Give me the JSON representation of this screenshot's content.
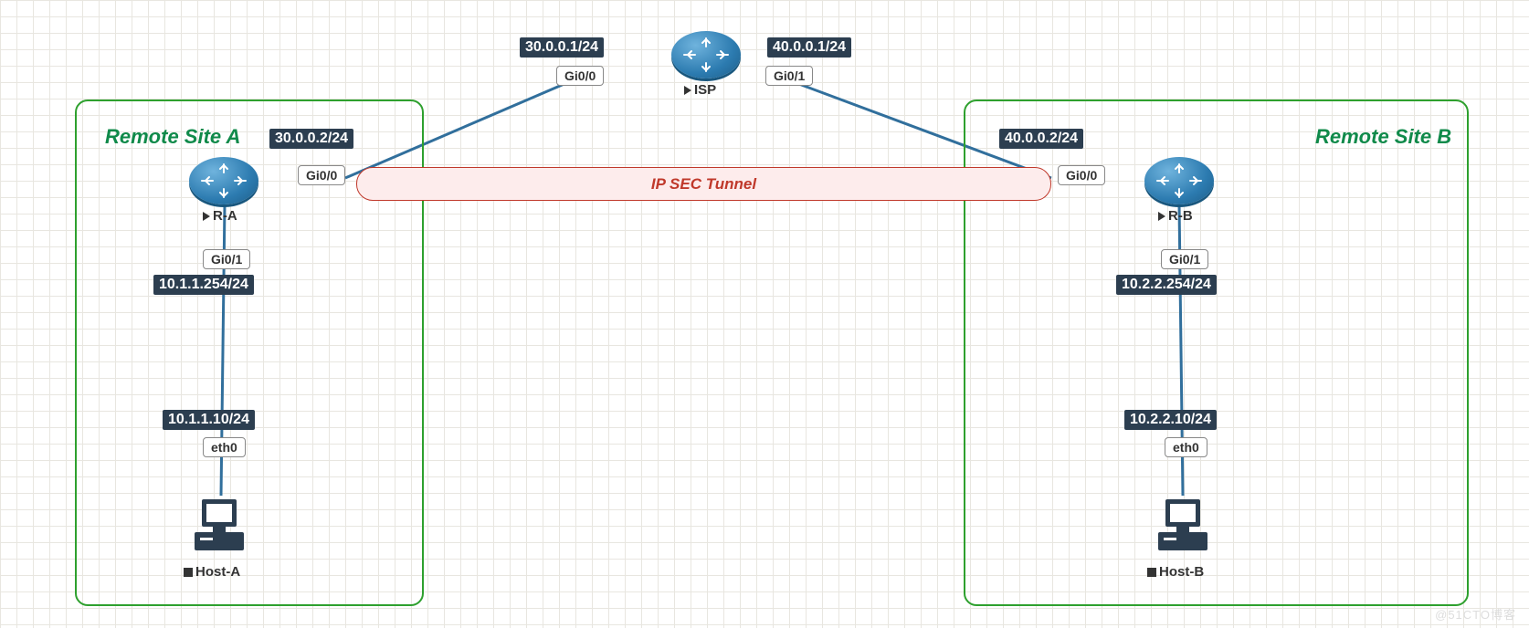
{
  "sites": {
    "a": {
      "title": "Remote Site A"
    },
    "b": {
      "title": "Remote Site B"
    }
  },
  "tunnel": {
    "label": "IP SEC Tunnel"
  },
  "devices": {
    "isp": {
      "label": "ISP",
      "type": "router"
    },
    "ra": {
      "label": "R-A",
      "type": "router"
    },
    "rb": {
      "label": "R-B",
      "type": "router"
    },
    "hosta": {
      "label": "Host-A",
      "type": "host"
    },
    "hostb": {
      "label": "Host-B",
      "type": "host"
    }
  },
  "addresses": {
    "isp_g00": "30.0.0.1/24",
    "isp_g01": "40.0.0.1/24",
    "ra_g00": "30.0.0.2/24",
    "rb_g00": "40.0.0.2/24",
    "ra_g01": "10.1.1.254/24",
    "rb_g01": "10.2.2.254/24",
    "hosta": "10.1.1.10/24",
    "hostb": "10.2.2.10/24"
  },
  "ports": {
    "isp_g00": "Gi0/0",
    "isp_g01": "Gi0/1",
    "ra_g00": "Gi0/0",
    "rb_g00": "Gi0/0",
    "ra_g01": "Gi0/1",
    "rb_g01": "Gi0/1",
    "hosta_eth0": "eth0",
    "hostb_eth0": "eth0"
  },
  "links": [
    {
      "from": "isp:Gi0/0",
      "to": "ra:Gi0/0"
    },
    {
      "from": "isp:Gi0/1",
      "to": "rb:Gi0/0"
    },
    {
      "from": "ra:Gi0/1",
      "to": "hosta:eth0"
    },
    {
      "from": "rb:Gi0/1",
      "to": "hostb:eth0"
    }
  ],
  "watermark": "@51CTO博客"
}
